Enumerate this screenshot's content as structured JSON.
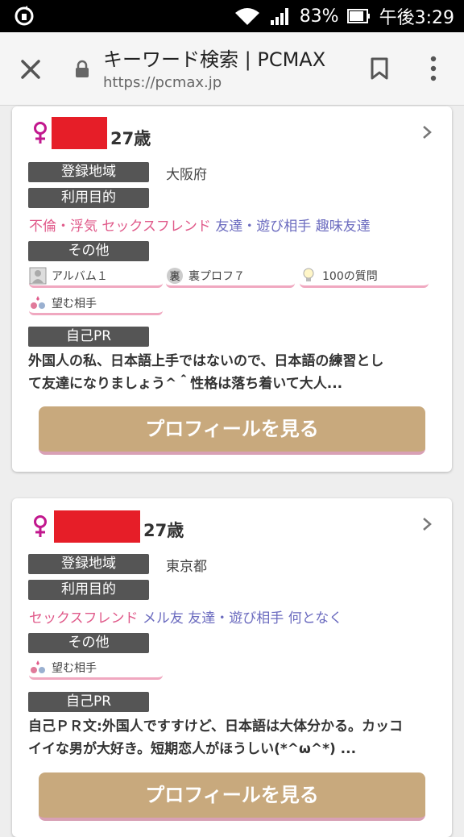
{
  "status_bar": {
    "battery": "83%",
    "time": "午後3:29"
  },
  "browser": {
    "title": "キーワード検索 | PCMAX",
    "url": "https://pcmax.jp"
  },
  "cards": [
    {
      "age": "27歳",
      "region_label": "登録地域",
      "region": "大阪府",
      "purpose_label": "利用目的",
      "purposes_pink": "不倫・浮気 セックスフレンド",
      "purposes_blue": "友達・遊び相手 趣味友達",
      "other_label": "その他",
      "chips": [
        "アルバム１",
        "裏プロフ７",
        "100の質問",
        "望む相手"
      ],
      "pr_label": "自己PR",
      "pr_line1": "外国人の私、日本語上手ではないので、日本語の練習とし",
      "pr_line2": "て友達になりましょう^＾性格は落ち着いて大人...",
      "button": "プロフィールを見る"
    },
    {
      "age": "27歳",
      "region_label": "登録地域",
      "region": "東京都",
      "purpose_label": "利用目的",
      "purposes_pink": "セックスフレンド",
      "purposes_blue": "メル友 友達・遊び相手 何となく",
      "other_label": "その他",
      "chips": [
        "望む相手"
      ],
      "pr_label": "自己PR",
      "pr_line1": "自己ＰＲ文:外国人ですすけど、日本語は大体分かる。カッコ",
      "pr_line2": "イイな男が大好き。短期恋人がほうしい(*^ω^*) ...",
      "button": "プロフィールを見る"
    }
  ],
  "colors": {
    "accent_pink": "#e05a8a",
    "accent_blue": "#6b6bbf",
    "button": "#c8a97d",
    "label_bg": "#555555",
    "redaction": "#e61e28"
  },
  "icons": [
    "sync-icon",
    "wifi-icon",
    "signal-icon",
    "battery-icon",
    "close-icon",
    "lock-icon",
    "bookmark-icon",
    "more-vert-icon",
    "female-icon",
    "chevron-right-icon",
    "album-icon",
    "ura-profile-icon",
    "question-bulb-icon",
    "hearts-icon"
  ]
}
